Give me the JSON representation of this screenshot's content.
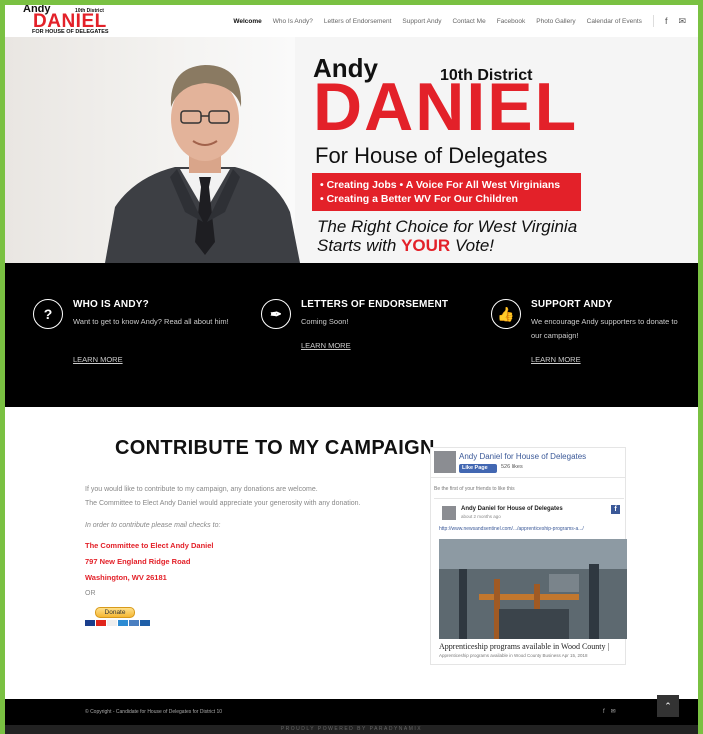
{
  "logo": {
    "andy": "Andy",
    "district": "10th District",
    "daniel": "DANIEL",
    "house": "FOR HOUSE OF DELEGATES"
  },
  "nav": {
    "items": [
      "Welcome",
      "Who Is Andy?",
      "Letters of Endorsement",
      "Support Andy",
      "Contact Me",
      "Facebook",
      "Photo Gallery",
      "Calendar of Events"
    ],
    "icons": [
      "facebook-icon",
      "mail-icon"
    ]
  },
  "hero": {
    "andy": "Andy",
    "district": "10th District",
    "daniel": "DANIEL",
    "house": "For House of Delegates",
    "bullets": [
      "• Creating Jobs  • A Voice For All West Virginians",
      "• Creating a Better WV For Our Children"
    ],
    "right_line1": "The Right Choice for West Virginia",
    "right_line2_pre": "Starts with ",
    "right_line2_your": "YOUR",
    "right_line2_post": " Vote!"
  },
  "features": [
    {
      "icon": "question-icon",
      "title": "WHO IS ANDY?",
      "desc": "Want to get to know Andy? Read all about him!",
      "link": "LEARN MORE"
    },
    {
      "icon": "feather-icon",
      "title": "LETTERS OF ENDORSEMENT",
      "desc": "Coming Soon!",
      "link": "LEARN MORE"
    },
    {
      "icon": "thumbs-up-icon",
      "title": "SUPPORT ANDY",
      "desc": "We encourage Andy supporters to donate to our campaign!",
      "link": "LEARN MORE"
    }
  ],
  "contribute": {
    "title": "CONTRIBUTE TO MY CAMPAIGN",
    "p1": "If you would like to contribute to my campaign, any donations are welcome.",
    "p2": "The Committee to Elect Andy Daniel would appreciate your generosity with any donation.",
    "p3": "In order to contribute please mail checks to:",
    "addr1": "The Committee to Elect Andy Daniel",
    "addr2": "797 New England Ridge Road",
    "addr3": "Washington, WV 26181",
    "or": "OR",
    "donate": "Donate"
  },
  "facebook": {
    "page_name": "Andy Daniel for House of Delegates",
    "like_btn": "Like Page",
    "likes": "526 likes",
    "first": "Be the first of your friends to like this",
    "post_title": "Andy Daniel for House of Delegates",
    "post_time": "about 2 months ago",
    "post_url": "http://www.newsandsentinel.com/.../apprenticeship-programs-a.../",
    "headline": "Apprenticeship programs available in Wood County |",
    "subline": "Apprenticeship programs available in Wood County Business Apr 15, 2018"
  },
  "footer": {
    "copyright": "© Copyright - Candidate for House of Delegates for District 10",
    "powered": "PROUDLY POWERED BY PARADYNAMIX"
  }
}
